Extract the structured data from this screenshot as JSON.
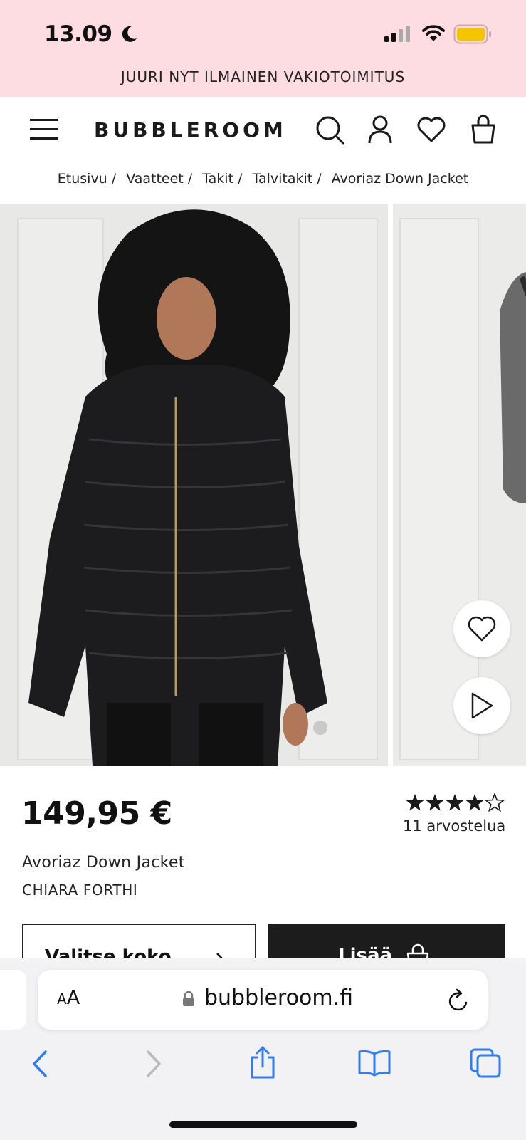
{
  "status_bar": {
    "time": "13.09",
    "battery_color": "#f5c400"
  },
  "promo": {
    "text": "JUURI NYT ILMAINEN VAKIOTOIMITUS",
    "background": "#fddde2"
  },
  "header": {
    "logo": "BUBBLEROOM",
    "icons": [
      "menu-icon",
      "search-icon",
      "account-icon",
      "wishlist-icon",
      "bag-icon"
    ]
  },
  "breadcrumb": {
    "items": [
      "Etusivu",
      "Vaatteet",
      "Takit",
      "Talvitakit",
      "Avoriaz Down Jacket"
    ],
    "separator": "/"
  },
  "gallery": {
    "icons": [
      "heart-icon",
      "play-icon"
    ],
    "dots_shown": 1
  },
  "product": {
    "price": "149,95 €",
    "rating": 4,
    "rating_max": 5,
    "reviews_label": "11 arvostelua",
    "name": "Avoriaz Down Jacket",
    "brand": "CHIARA FORTHI",
    "size_button_label": "Valitse koko",
    "add_button_label": "Lisää"
  },
  "browser": {
    "aa_label_small": "A",
    "aa_label_large": "A",
    "url": "bubbleroom.fi",
    "accent_color": "#2f7cf6",
    "toolbar_icons": [
      "back-icon",
      "forward-icon",
      "share-icon",
      "bookmarks-icon",
      "tabs-icon"
    ]
  }
}
